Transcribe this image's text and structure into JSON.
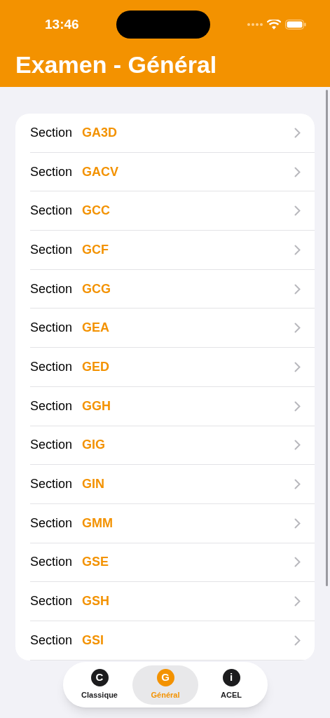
{
  "status_bar": {
    "time": "13:46"
  },
  "title": "Examen - Général",
  "sections": [
    {
      "label": "Section",
      "code": "GA3D"
    },
    {
      "label": "Section",
      "code": "GACV"
    },
    {
      "label": "Section",
      "code": "GCC"
    },
    {
      "label": "Section",
      "code": "GCF"
    },
    {
      "label": "Section",
      "code": "GCG"
    },
    {
      "label": "Section",
      "code": "GEA"
    },
    {
      "label": "Section",
      "code": "GED"
    },
    {
      "label": "Section",
      "code": "GGH"
    },
    {
      "label": "Section",
      "code": "GIG"
    },
    {
      "label": "Section",
      "code": "GIN"
    },
    {
      "label": "Section",
      "code": "GMM"
    },
    {
      "label": "Section",
      "code": "GSE"
    },
    {
      "label": "Section",
      "code": "GSH"
    },
    {
      "label": "Section",
      "code": "GSI"
    }
  ],
  "tabs": [
    {
      "letter": "C",
      "label": "Classique",
      "selected": false
    },
    {
      "letter": "G",
      "label": "Général",
      "selected": true
    },
    {
      "letter": "i",
      "label": "ACEL",
      "selected": false
    }
  ]
}
